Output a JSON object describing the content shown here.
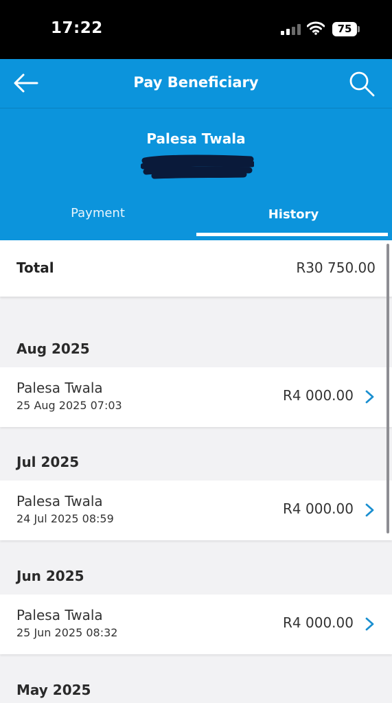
{
  "status": {
    "time": "17:22",
    "battery": "75"
  },
  "header": {
    "title": "Pay Beneficiary",
    "beneficiary_name": "Palesa Twala",
    "tabs": [
      {
        "label": "Payment",
        "active": false
      },
      {
        "label": "History",
        "active": true
      }
    ]
  },
  "total": {
    "label": "Total",
    "value": "R30 750.00"
  },
  "months": [
    {
      "label": "Aug 2025",
      "transactions": [
        {
          "name": "Palesa Twala",
          "date": "25 Aug 2025 07:03",
          "amount": "R4 000.00"
        }
      ]
    },
    {
      "label": "Jul 2025",
      "transactions": [
        {
          "name": "Palesa Twala",
          "date": "24 Jul 2025 08:59",
          "amount": "R4 000.00"
        }
      ]
    },
    {
      "label": "Jun 2025",
      "transactions": [
        {
          "name": "Palesa Twala",
          "date": "25 Jun 2025 08:32",
          "amount": "R4 000.00"
        }
      ]
    },
    {
      "label": "May 2025",
      "transactions": []
    }
  ],
  "colors": {
    "header_blue": "#0c94dc",
    "accent_chevron": "#1a8fd0",
    "background": "#f2f2f4"
  }
}
